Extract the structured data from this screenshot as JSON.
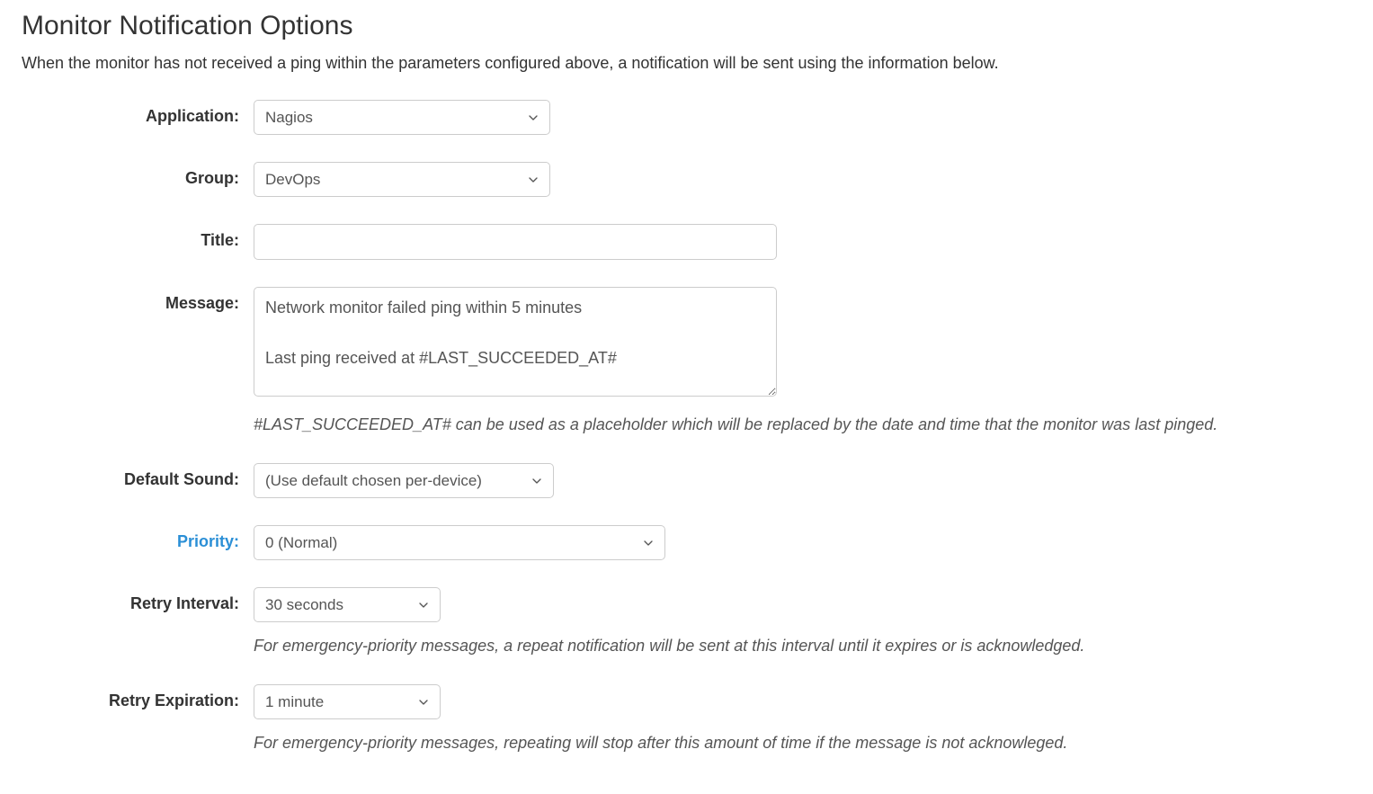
{
  "heading": "Monitor Notification Options",
  "description": "When the monitor has not received a ping within the parameters configured above, a notification will be sent using the information below.",
  "fields": {
    "application": {
      "label": "Application:",
      "value": "Nagios"
    },
    "group": {
      "label": "Group:",
      "value": "DevOps"
    },
    "title": {
      "label": "Title:",
      "value": ""
    },
    "message": {
      "label": "Message:",
      "value": "Network monitor failed ping within 5 minutes\n\nLast ping received at #LAST_SUCCEEDED_AT#",
      "help": "#LAST_SUCCEEDED_AT# can be used as a placeholder which will be replaced by the date and time that the monitor was last pinged."
    },
    "default_sound": {
      "label": "Default Sound:",
      "value": "(Use default chosen per-device)"
    },
    "priority": {
      "label": "Priority:",
      "value": "0 (Normal)"
    },
    "retry_interval": {
      "label": "Retry Interval:",
      "value": "30 seconds",
      "help": "For emergency-priority messages, a repeat notification will be sent at this interval until it expires or is acknowledged."
    },
    "retry_expiration": {
      "label": "Retry Expiration:",
      "value": "1 minute",
      "help": "For emergency-priority messages, repeating will stop after this amount of time if the message is not acknowleged."
    }
  }
}
